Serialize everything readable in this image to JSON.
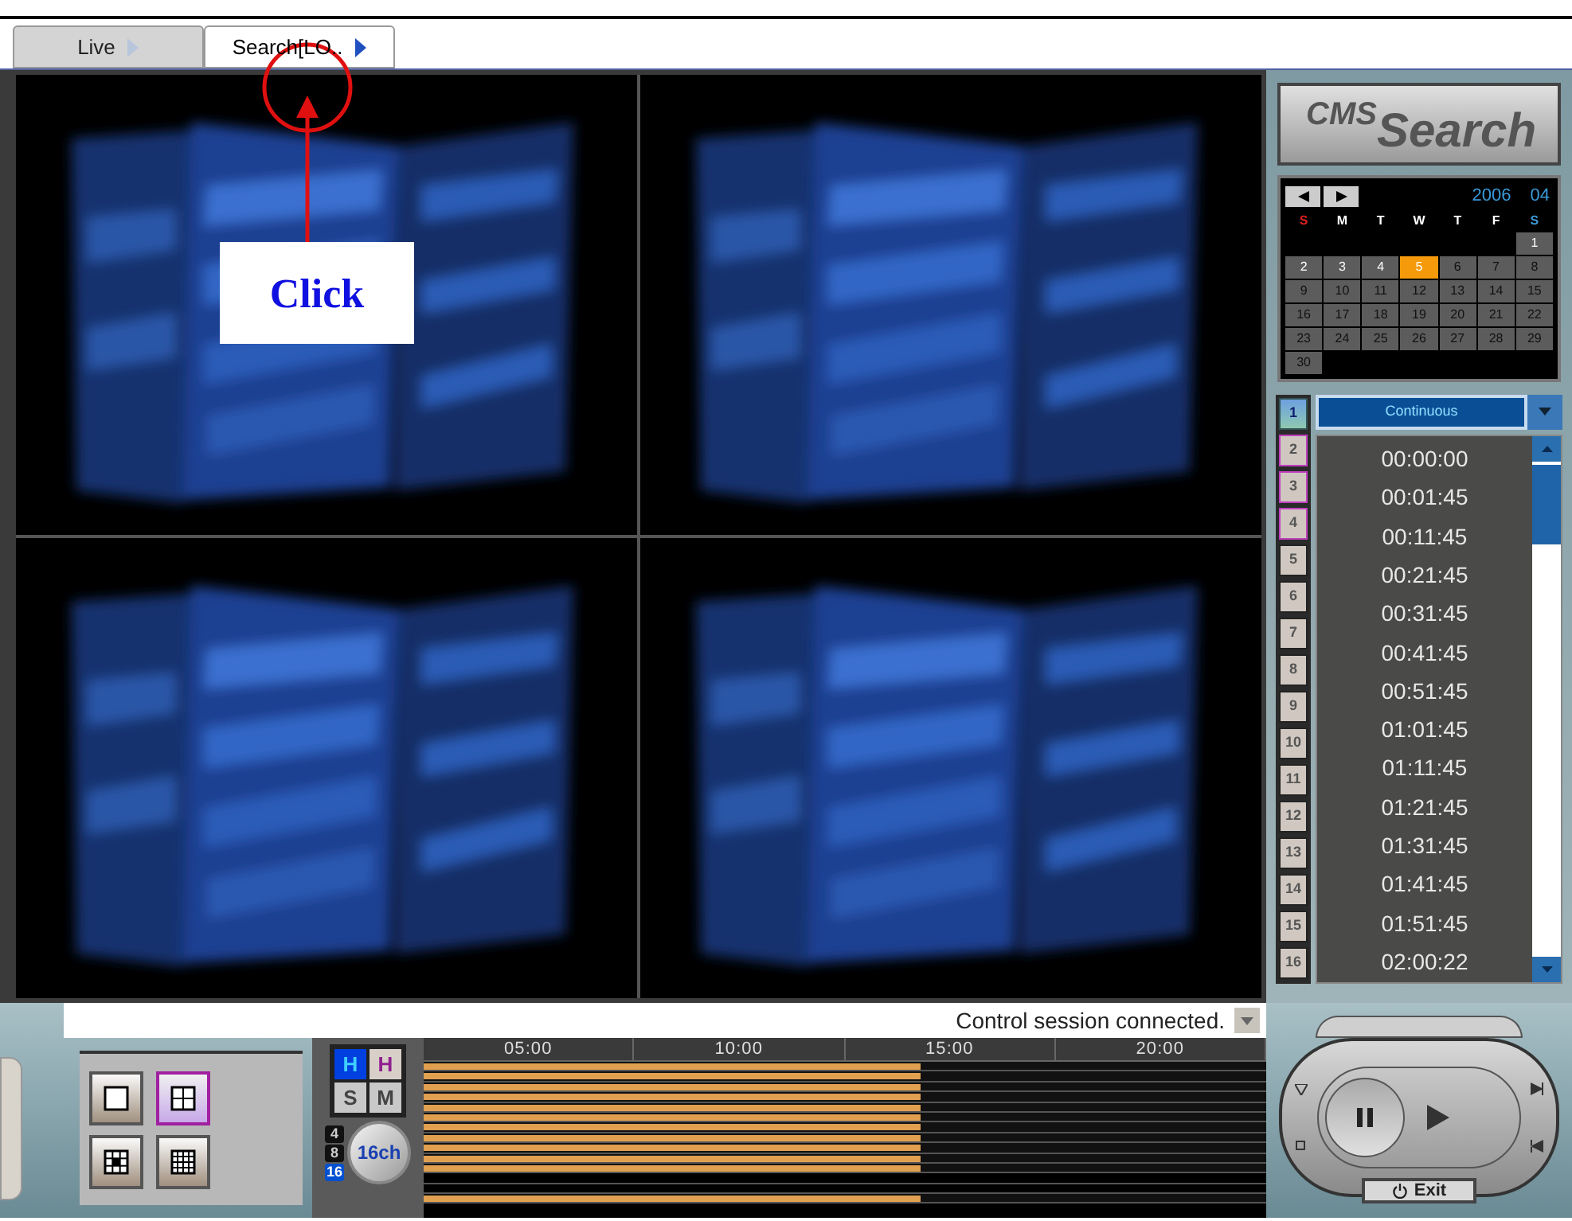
{
  "tabs": [
    {
      "label": "Live",
      "selected": false
    },
    {
      "label": "Search[LO..",
      "selected": true
    }
  ],
  "annotation": {
    "text": "Click"
  },
  "logo": [
    "CMS",
    "Search"
  ],
  "videos": [
    {
      "kind": "picture"
    },
    {
      "kind": "picture"
    },
    {
      "kind": "picture"
    },
    {
      "kind": "picture"
    }
  ],
  "calendar": {
    "year": "2006",
    "month": "04",
    "weekdays": [
      "S",
      "M",
      "T",
      "W",
      "T",
      "F",
      "S"
    ],
    "days": [
      {
        "label": "1",
        "recorded": true,
        "selected": false
      },
      {
        "label": "2",
        "recorded": true,
        "selected": false
      },
      {
        "label": "3",
        "recorded": true,
        "selected": false
      },
      {
        "label": "4",
        "recorded": true,
        "selected": false
      },
      {
        "label": "5",
        "recorded": true,
        "selected": true
      },
      {
        "label": "6",
        "recorded": false,
        "selected": false
      },
      {
        "label": "7",
        "recorded": false,
        "selected": false
      },
      {
        "label": "8",
        "recorded": false,
        "selected": false
      },
      {
        "label": "9",
        "recorded": false,
        "selected": false
      },
      {
        "label": "10",
        "recorded": false,
        "selected": false
      },
      {
        "label": "11",
        "recorded": false,
        "selected": false
      },
      {
        "label": "12",
        "recorded": false,
        "selected": false
      },
      {
        "label": "13",
        "recorded": false,
        "selected": false
      },
      {
        "label": "14",
        "recorded": false,
        "selected": false
      },
      {
        "label": "15",
        "recorded": false,
        "selected": false
      },
      {
        "label": "16",
        "recorded": false,
        "selected": false
      },
      {
        "label": "17",
        "recorded": false,
        "selected": false
      },
      {
        "label": "18",
        "recorded": false,
        "selected": false
      },
      {
        "label": "19",
        "recorded": false,
        "selected": false
      },
      {
        "label": "20",
        "recorded": false,
        "selected": false
      },
      {
        "label": "21",
        "recorded": false,
        "selected": false
      },
      {
        "label": "22",
        "recorded": false,
        "selected": false
      },
      {
        "label": "23",
        "recorded": false,
        "selected": false
      },
      {
        "label": "24",
        "recorded": false,
        "selected": false
      },
      {
        "label": "25",
        "recorded": false,
        "selected": false
      },
      {
        "label": "26",
        "recorded": false,
        "selected": false
      },
      {
        "label": "27",
        "recorded": false,
        "selected": false
      },
      {
        "label": "28",
        "recorded": false,
        "selected": false
      },
      {
        "label": "29",
        "recorded": false,
        "selected": false
      },
      {
        "label": "30",
        "recorded": false,
        "selected": false
      }
    ]
  },
  "channels": [
    {
      "label": "1",
      "selected": true,
      "highlighted": false
    },
    {
      "label": "2",
      "selected": false,
      "highlighted": true
    },
    {
      "label": "3",
      "selected": false,
      "highlighted": true
    },
    {
      "label": "4",
      "selected": false,
      "highlighted": true
    },
    {
      "label": "5",
      "selected": false,
      "highlighted": false
    },
    {
      "label": "6",
      "selected": false,
      "highlighted": false
    },
    {
      "label": "7",
      "selected": false,
      "highlighted": false
    },
    {
      "label": "8",
      "selected": false,
      "highlighted": false
    },
    {
      "label": "9",
      "selected": false,
      "highlighted": false
    },
    {
      "label": "10",
      "selected": false,
      "highlighted": false
    },
    {
      "label": "11",
      "selected": false,
      "highlighted": false
    },
    {
      "label": "12",
      "selected": false,
      "highlighted": false
    },
    {
      "label": "13",
      "selected": false,
      "highlighted": false
    },
    {
      "label": "14",
      "selected": false,
      "highlighted": false
    },
    {
      "label": "15",
      "selected": false,
      "highlighted": false
    },
    {
      "label": "16",
      "selected": false,
      "highlighted": false
    }
  ],
  "record_type": {
    "value": "Continuous"
  },
  "times": [
    "00:00:00",
    "00:01:45",
    "00:11:45",
    "00:21:45",
    "00:31:45",
    "00:41:45",
    "00:51:45",
    "01:01:45",
    "01:11:45",
    "01:21:45",
    "01:31:45",
    "01:41:45",
    "01:51:45",
    "02:00:22"
  ],
  "status": {
    "text": "Control session connected."
  },
  "layouts": [
    {
      "kind": "single",
      "selected": false
    },
    {
      "kind": "quad",
      "selected": true
    },
    {
      "kind": "nine",
      "selected": false
    },
    {
      "kind": "sixteen",
      "selected": false
    }
  ],
  "modes": [
    {
      "label": "H",
      "selected": true
    },
    {
      "label": "H",
      "selected": false
    },
    {
      "label": "S",
      "selected": false
    },
    {
      "label": "M",
      "selected": false
    }
  ],
  "channel_counts": [
    {
      "label": "4",
      "selected": false
    },
    {
      "label": "8",
      "selected": false
    },
    {
      "label": "16",
      "selected": true
    }
  ],
  "channel_dial": {
    "label": "16ch"
  },
  "timeline": {
    "hours": [
      "05:00",
      "10:00",
      "15:00",
      "20:00"
    ],
    "rows": [
      {
        "recorded": true,
        "level": 0.59
      },
      {
        "recorded": true,
        "level": 0.59
      },
      {
        "recorded": true,
        "level": 0.59
      },
      {
        "recorded": true,
        "level": 0.59
      },
      {
        "recorded": true,
        "level": 0.59
      },
      {
        "recorded": true,
        "level": 0.59
      },
      {
        "recorded": true,
        "level": 0.59
      },
      {
        "recorded": true,
        "level": 0.59
      },
      {
        "recorded": true,
        "level": 0.59
      },
      {
        "recorded": true,
        "level": 0.59
      },
      {
        "recorded": true,
        "level": 0.59
      },
      {
        "recorded": false
      },
      {
        "recorded": false
      },
      {
        "recorded": true,
        "level": 0.59
      }
    ]
  },
  "exit_button": {
    "label": "Exit"
  }
}
